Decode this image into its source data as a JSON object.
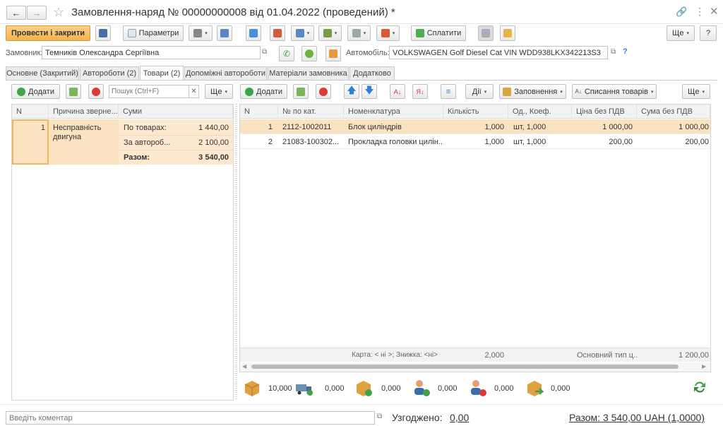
{
  "window": {
    "title": "Замовлення-наряд № 00000000008 від 01.04.2022 (проведений) *"
  },
  "toolbar": {
    "post_close": "Провести і закрити",
    "params": "Параметри",
    "pay": "Сплатити",
    "more": "Ще",
    "help": "?"
  },
  "form": {
    "customer_label": "Замовник:",
    "customer": "Темників Олександра Сергіївна",
    "car_label": "Автомобіль:",
    "car": "VOLKSWAGEN Golf Diesel Cat VIN WDD938LKX342213S3",
    "car_help": "?"
  },
  "tabs": [
    {
      "label": "Основне (Закритий)"
    },
    {
      "label": "Автороботи (2)"
    },
    {
      "label": "Товари (2)"
    },
    {
      "label": "Допоміжні автороботи"
    },
    {
      "label": "Матеріали замовника"
    },
    {
      "label": "Додатково"
    }
  ],
  "left_panel": {
    "add": "Додати",
    "search_placeholder": "Пошук (Ctrl+F)",
    "more": "Ще",
    "columns": [
      "N",
      "Причина зверне...",
      "Суми"
    ],
    "row": {
      "n": "1",
      "reason": "Несправність двигуна",
      "sums": [
        {
          "label": "По товарах:",
          "value": "1 440,00"
        },
        {
          "label": "За автороб...",
          "value": "2 100,00"
        },
        {
          "label": "Разом:",
          "value": "3 540,00"
        }
      ]
    }
  },
  "right_panel": {
    "add": "Додати",
    "actions": "Дії",
    "fill": "Заповнення",
    "writeoff": "Списання товарів",
    "more": "Ще",
    "columns": [
      "N",
      "№ по кат.",
      "Номенклатура",
      "Кількість",
      "Од., Коеф.",
      "Ціна без ПДВ",
      "Сума без ПДВ"
    ],
    "rows": [
      {
        "n": "1",
        "cat": "2112-1002011",
        "name": "Блок циліндрів",
        "qty": "1,000",
        "unit": "шт, 1,000",
        "price": "1 000,00",
        "sum": "1 000,00"
      },
      {
        "n": "2",
        "cat": "21083-100302...",
        "name": "Прокладка головки цилін...",
        "qty": "1,000",
        "unit": "шт, 1,000",
        "price": "200,00",
        "sum": "200,00"
      }
    ],
    "footer": {
      "card": "Карта: < ні >; Знижка: <ні>",
      "qty_total": "2,000",
      "price_type": "Основний тип ц...",
      "sum_total": "1 200,00"
    }
  },
  "stats": [
    "10,000",
    "0,000",
    "0,000",
    "0,000",
    "0,000",
    "0,000"
  ],
  "bottom": {
    "comment_placeholder": "Введіть коментар",
    "agreed_label": "Узгоджено:",
    "agreed_value": "0,00",
    "total": "Разом: 3 540,00 UAH (1,0000)"
  },
  "colors": {
    "accent_orange": "#f5c26b",
    "selected_row": "#fbe3c2",
    "sum_bg": "#fde9cf"
  }
}
